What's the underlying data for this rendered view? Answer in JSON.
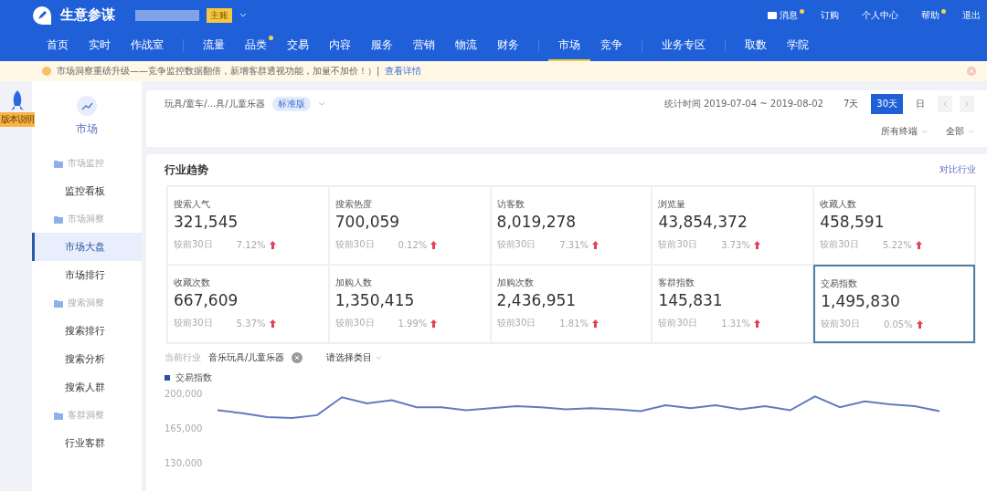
{
  "header": {
    "logo": "生意参谋",
    "shop_badge": "主账",
    "top_links": [
      {
        "label": "消息",
        "dot": true
      },
      {
        "label": "订购",
        "dot": false
      },
      {
        "label": "个人中心",
        "dot": false
      },
      {
        "label": "帮助",
        "dot": true
      },
      {
        "label": "退出",
        "dot": false
      }
    ]
  },
  "nav": [
    [
      {
        "label": "首页",
        "selected": false,
        "dot": false
      },
      {
        "label": "实时",
        "selected": false,
        "dot": false
      },
      {
        "label": "作战室",
        "selected": false,
        "dot": false
      }
    ],
    [
      {
        "label": "流量",
        "selected": false,
        "dot": false
      },
      {
        "label": "品类",
        "selected": false,
        "dot": true
      },
      {
        "label": "交易",
        "selected": false,
        "dot": false
      },
      {
        "label": "内容",
        "selected": false,
        "dot": false
      },
      {
        "label": "服务",
        "selected": false,
        "dot": false
      },
      {
        "label": "营销",
        "selected": false,
        "dot": false
      },
      {
        "label": "物流",
        "selected": false,
        "dot": false
      },
      {
        "label": "财务",
        "selected": false,
        "dot": false
      }
    ],
    [
      {
        "label": "市场",
        "selected": true,
        "dot": false
      },
      {
        "label": "竞争",
        "selected": false,
        "dot": false
      }
    ],
    [
      {
        "label": "业务专区",
        "selected": false,
        "dot": false
      }
    ],
    [
      {
        "label": "取数",
        "selected": false,
        "dot": false
      },
      {
        "label": "学院",
        "selected": false,
        "dot": false
      }
    ]
  ],
  "notice": {
    "text": "市场洞察重磅升级——竞争监控数据翻倍，新增客群透视功能，加量不加价！）|",
    "link": "查看详情"
  },
  "version_badge": "版本说明",
  "sidebar": {
    "title": "市场",
    "groups": [
      {
        "label": "市场监控",
        "items": [
          {
            "label": "监控看板",
            "selected": false
          }
        ]
      },
      {
        "label": "市场洞察",
        "items": [
          {
            "label": "市场大盘",
            "selected": true
          },
          {
            "label": "市场排行",
            "selected": false
          }
        ]
      },
      {
        "label": "搜索洞察",
        "items": [
          {
            "label": "搜索排行",
            "selected": false
          },
          {
            "label": "搜索分析",
            "selected": false
          },
          {
            "label": "搜索人群",
            "selected": false
          }
        ]
      },
      {
        "label": "客群洞察",
        "items": [
          {
            "label": "行业客群",
            "selected": false
          }
        ]
      }
    ]
  },
  "filter": {
    "category": "玩具/童车/...具/儿童乐器",
    "edition": "标准版",
    "period_label": "统计时间 2019-07-04 ~ 2019-08-02",
    "periods": [
      {
        "label": "7天",
        "selected": false
      },
      {
        "label": "30天",
        "selected": true
      },
      {
        "label": "日",
        "selected": false
      }
    ],
    "dropdowns": [
      "所有终端",
      "全部"
    ]
  },
  "trend": {
    "title": "行业趋势",
    "compare_link": "对比行业",
    "metrics": [
      {
        "label": "搜索人气",
        "value": "321,545",
        "compare": "较前30日",
        "change": "7.12%",
        "selected": false
      },
      {
        "label": "搜索热度",
        "value": "700,059",
        "compare": "较前30日",
        "change": "0.12%",
        "selected": false
      },
      {
        "label": "访客数",
        "value": "8,019,278",
        "compare": "较前30日",
        "change": "7.31%",
        "selected": false
      },
      {
        "label": "浏览量",
        "value": "43,854,372",
        "compare": "较前30日",
        "change": "3.73%",
        "selected": false
      },
      {
        "label": "收藏人数",
        "value": "458,591",
        "compare": "较前30日",
        "change": "5.22%",
        "selected": false
      },
      {
        "label": "收藏次数",
        "value": "667,609",
        "compare": "较前30日",
        "change": "5.37%",
        "selected": false
      },
      {
        "label": "加购人数",
        "value": "1,350,415",
        "compare": "较前30日",
        "change": "1.99%",
        "selected": false
      },
      {
        "label": "加购次数",
        "value": "2,436,951",
        "compare": "较前30日",
        "change": "1.81%",
        "selected": false
      },
      {
        "label": "客群指数",
        "value": "145,831",
        "compare": "较前30日",
        "change": "1.31%",
        "selected": false
      },
      {
        "label": "交易指数",
        "value": "1,495,830",
        "compare": "较前30日",
        "change": "0.05%",
        "selected": true
      }
    ],
    "industry_label": "当前行业",
    "industry": "音乐玩具/儿童乐器",
    "category_select": "请选择类目",
    "chart_data": {
      "type": "line",
      "ylim": [
        130000,
        200000
      ],
      "yticks": [
        {
          "value": 200000,
          "label": "200,000"
        },
        {
          "value": 165000,
          "label": "165,000"
        },
        {
          "value": 130000,
          "label": "130,000"
        }
      ],
      "series": [
        {
          "name": "交易指数",
          "color": "#2d4fa8",
          "values": [
            183000,
            180000,
            176000,
            175000,
            178000,
            196000,
            190000,
            193000,
            186000,
            186000,
            183000,
            185000,
            187000,
            186000,
            184000,
            185000,
            184000,
            182000,
            188000,
            185000,
            188000,
            184000,
            187000,
            183000,
            197000,
            186000,
            192000,
            189000,
            187000,
            182000
          ]
        }
      ]
    }
  }
}
